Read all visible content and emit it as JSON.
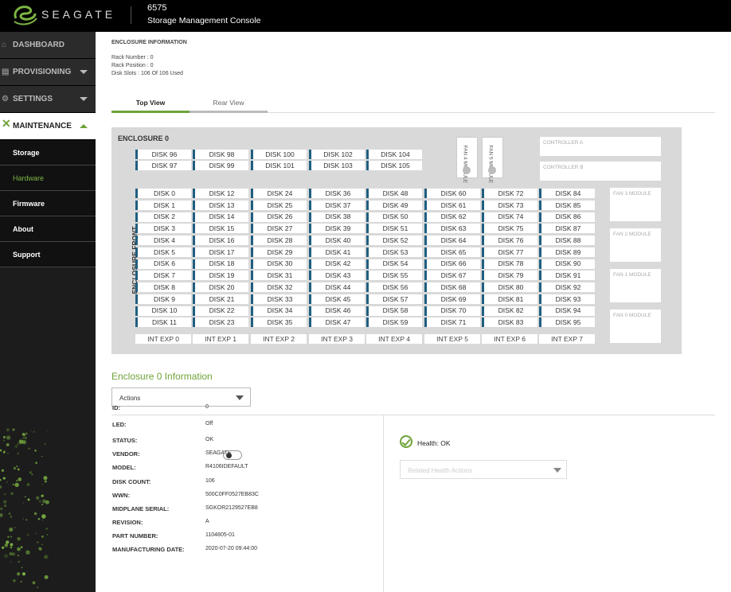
{
  "header": {
    "brand": "SEAGATE",
    "system_name": "6575",
    "system_subtitle": "Storage Management Console"
  },
  "sidebar": {
    "items": [
      {
        "label": "DASHBOARD",
        "icon": "home-icon"
      },
      {
        "label": "PROVISIONING",
        "icon": "provisioning-icon"
      },
      {
        "label": "SETTINGS",
        "icon": "gear-icon"
      },
      {
        "label": "MAINTENANCE",
        "icon": "wrench-icon"
      }
    ],
    "maintenance_sub": [
      "Storage",
      "Hardware",
      "Firmware",
      "About",
      "Support"
    ],
    "selected_sub": "Hardware"
  },
  "enclosure_info": {
    "heading": "ENCLOSURE INFORMATION",
    "rack_number": "Rack Number : 0",
    "rack_position": "Rack Position : 0",
    "disk_slots": "Disk Slots : 106 Of 106 Used"
  },
  "tabs": [
    {
      "label": "Top View",
      "active": true
    },
    {
      "label": "Rear View",
      "active": false
    }
  ],
  "diagram": {
    "title": "ENCLOSURE 0",
    "front_label": "ENCLOSURE FRONT",
    "top_disks": [
      [
        "DISK 96",
        "DISK 97"
      ],
      [
        "DISK 98",
        "DISK 99"
      ],
      [
        "DISK 100",
        "DISK 101"
      ],
      [
        "DISK 102",
        "DISK 103"
      ],
      [
        "DISK 104",
        "DISK 105"
      ]
    ],
    "main_disk_columns": 8,
    "main_disk_rows": 12,
    "int_exp": [
      "INT EXP 0",
      "INT EXP 1",
      "INT EXP 2",
      "INT EXP 3",
      "INT EXP 4",
      "INT EXP 5",
      "INT EXP 6",
      "INT EXP 7"
    ],
    "fan_small": [
      "FAN 4 MODULE",
      "FAN 5 MODULE"
    ],
    "controllers": [
      "CONTROLLER A",
      "CONTROLLER B"
    ],
    "fan_modules": [
      "FAN 3 MODULE",
      "FAN 2 MODULE",
      "FAN 1 MODULE",
      "FAN 0 MODULE"
    ]
  },
  "info": {
    "title": "Enclosure 0 Information",
    "actions_label": "Actions",
    "fields": [
      {
        "label": "ID:",
        "value": "0"
      },
      {
        "label": "LED:",
        "value": "Off"
      },
      {
        "label": "STATUS:",
        "value": "OK"
      },
      {
        "label": "VENDOR:",
        "value": "SEAGATE"
      },
      {
        "label": "MODEL:",
        "value": "R4106IDEFAULT"
      },
      {
        "label": "DISK COUNT:",
        "value": "106"
      },
      {
        "label": "WWN:",
        "value": "500C0FF0527EB83C"
      },
      {
        "label": "MIDPLANE SERIAL:",
        "value": "SGKOR2129527EB8"
      },
      {
        "label": "REVISION:",
        "value": "A"
      },
      {
        "label": "PART NUMBER:",
        "value": "1104805-01"
      },
      {
        "label": "MANUFACTURING DATE:",
        "value": "2020-07-20 09:44:00"
      }
    ],
    "health_label": "Health: OK",
    "related_actions_placeholder": "Related Health Actions"
  },
  "colors": {
    "accent": "#6fa33a",
    "disk_marker": "#1f5f80",
    "panel": "#d9d9d9"
  }
}
